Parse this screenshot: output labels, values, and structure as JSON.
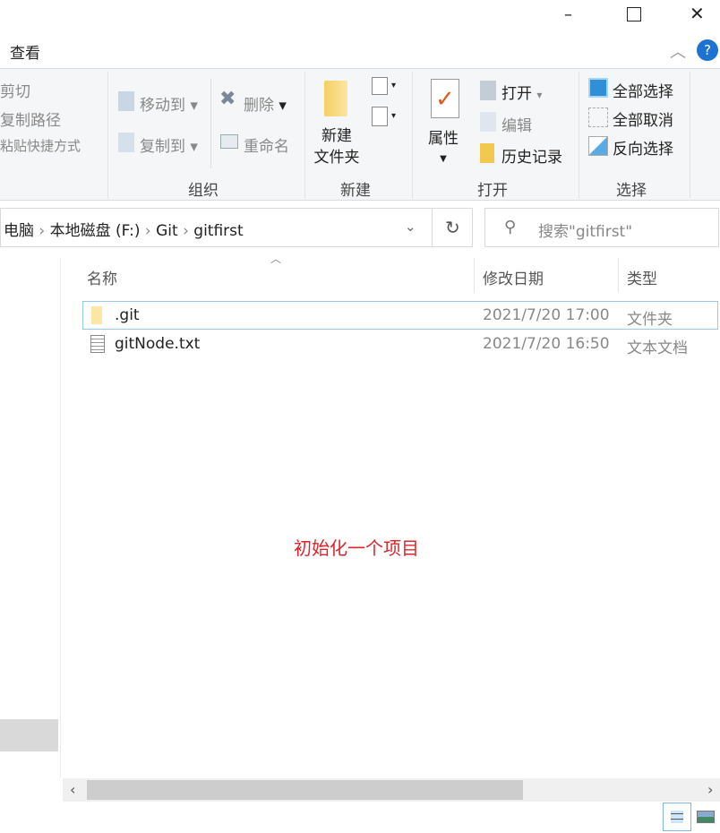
{
  "window": {
    "minimize": "–",
    "maximize": "☐",
    "close": "✕"
  },
  "menu": {
    "view_tab": "查看",
    "help": "?"
  },
  "ribbon": {
    "clipboard": {
      "cut": "剪切",
      "copy_path": "复制路径",
      "paste_shortcut": "粘贴快捷方式"
    },
    "organize": {
      "move_to": "移动到",
      "copy_to": "复制到",
      "delete": "删除",
      "rename": "重命名",
      "label": "组织"
    },
    "new": {
      "new_folder_line1": "新建",
      "new_folder_line2": "文件夹",
      "label": "新建"
    },
    "open": {
      "properties": "属性",
      "open": "打开",
      "edit": "编辑",
      "history": "历史记录",
      "label": "打开"
    },
    "select": {
      "select_all": "全部选择",
      "select_none": "全部取消",
      "invert": "反向选择",
      "label": "选择"
    }
  },
  "address": {
    "crumbs": [
      "电脑",
      "本地磁盘 (F:)",
      "Git",
      "gitfirst"
    ]
  },
  "search": {
    "placeholder": "搜索\"gitfirst\""
  },
  "columns": {
    "name": "名称",
    "modified": "修改日期",
    "type": "类型"
  },
  "files": [
    {
      "name": ".git",
      "modified": "2021/7/20 17:00",
      "type": "文件夹",
      "icon": "folder-icon"
    },
    {
      "name": "gitNode.txt",
      "modified": "2021/7/20 16:50",
      "type": "文本文档",
      "icon": "text-file-icon"
    }
  ],
  "annotation": {
    "text": "初始化一个项目",
    "color": "#e0242b"
  }
}
